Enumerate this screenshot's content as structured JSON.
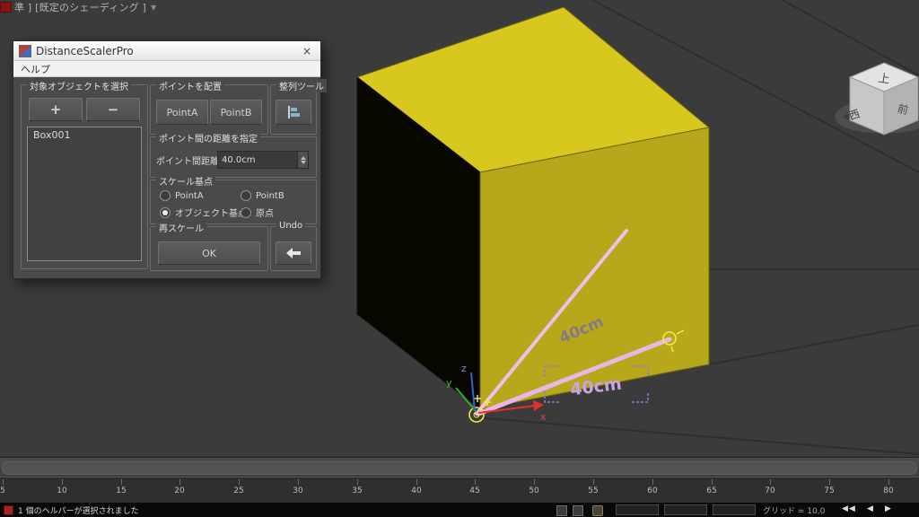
{
  "viewport_header": {
    "label": "準 ] [既定のシェーディング ]",
    "dropdown": "▼"
  },
  "dialog": {
    "title": "DistanceScalerPro",
    "close": "×",
    "menu_help": "ヘルプ",
    "select_group": {
      "caption": "対象オブジェクトを選択",
      "add": "+",
      "remove": "−",
      "items": [
        "Box001"
      ]
    },
    "points_group": {
      "caption": "ポイントを配置",
      "point_a": "PointA",
      "point_b": "PointB"
    },
    "align_group": {
      "caption": "整列ツール"
    },
    "distance_group": {
      "caption": "ポイント間の距離を指定",
      "field_label": "ポイント間距離",
      "value": "40.0cm"
    },
    "base_group": {
      "caption": "スケール基点",
      "options": [
        "PointA",
        "PointB",
        "オブジェクト基点",
        "原点"
      ],
      "selected": "オブジェクト基点"
    },
    "rescale_group": {
      "caption": "再スケール",
      "ok": "OK"
    },
    "undo_group": {
      "caption": "Undo"
    }
  },
  "scene": {
    "object_name": "Box001",
    "measure_label_diagonal": "40cm",
    "measure_label_bottom": "40cm",
    "axis": {
      "x": "x",
      "y": "y",
      "z": "z"
    },
    "viewcube": {
      "top": "上",
      "left": "西",
      "right": "前"
    },
    "colors": {
      "cube_top": "#d8c71e",
      "cube_front": "#b7a71a",
      "cube_left": "#070700",
      "measure_line": "#e8b7e5",
      "helper_yellow": "#eded4a"
    }
  },
  "timeline": {
    "ticks": [
      "5",
      "10",
      "15",
      "20",
      "25",
      "30",
      "35",
      "40",
      "45",
      "50",
      "55",
      "60",
      "65",
      "70",
      "75",
      "80"
    ]
  },
  "statusbar": {
    "message": "1 個のヘルパーが選択されました",
    "grid_label": "グリッド = 10.0",
    "transport": [
      "◀◀",
      "◀",
      "▶"
    ]
  }
}
